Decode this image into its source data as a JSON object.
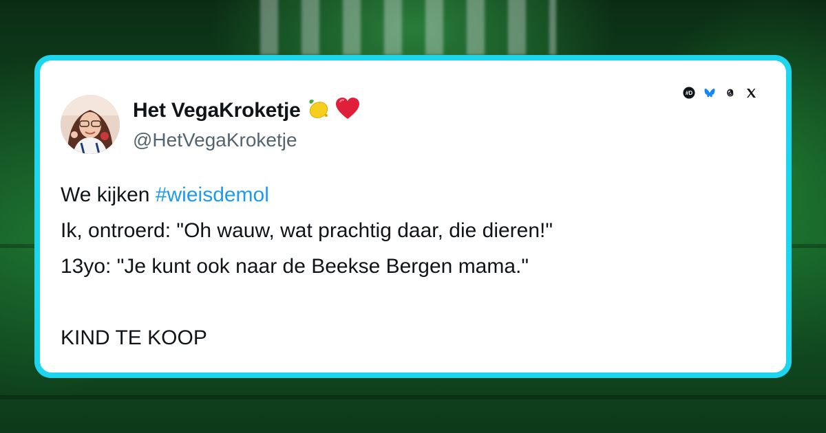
{
  "author": {
    "display_name": "Het VegaKroketje",
    "handle": "@HetVegaKroketje",
    "emojis": [
      "lemon-emoji",
      "red-heart-emoji"
    ]
  },
  "tweet": {
    "line1_prefix": "We kijken ",
    "line1_hashtag": "#wieisdemol",
    "line2": "Ik, ontroerd: \"Oh wauw, wat prachtig daar, die dieren!\"",
    "line3": "13yo: \"Je kunt ook naar de Beekse Bergen mama.\"",
    "line5": "KIND TE KOOP"
  },
  "socials": [
    "dumpert-icon",
    "bluesky-icon",
    "threads-icon",
    "x-icon"
  ],
  "colors": {
    "card_border": "#1ed5ee",
    "hashtag": "#1d9bf0",
    "text": "#0f1419",
    "handle": "#536471",
    "background": "#145a26"
  }
}
